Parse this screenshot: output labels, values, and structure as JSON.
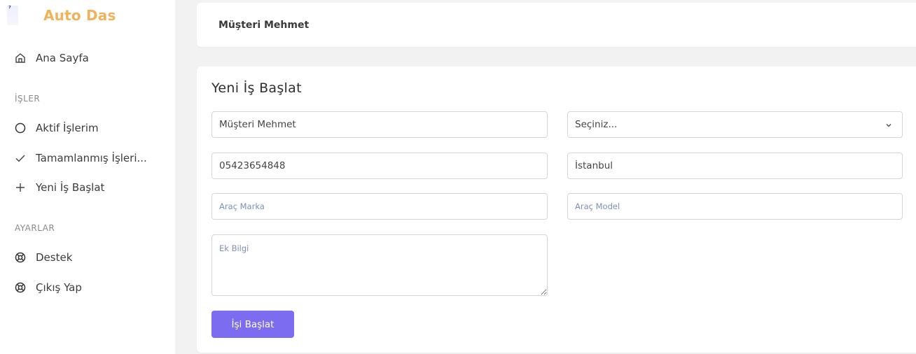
{
  "sidebar": {
    "brand": "Auto Das",
    "home": {
      "label": "Ana Sayfa",
      "icon": "home-icon"
    },
    "section_jobs": "İŞLER",
    "jobs_items": [
      {
        "label": "Aktif İşlerim",
        "icon": "circle-icon"
      },
      {
        "label": "Tamamlanmış İşleri...",
        "icon": "check-icon"
      },
      {
        "label": "Yeni İş Başlat",
        "icon": "plus-icon"
      }
    ],
    "section_settings": "AYARLAR",
    "settings_items": [
      {
        "label": "Destek",
        "icon": "lifebuoy-icon"
      },
      {
        "label": "Çıkış Yap",
        "icon": "lifebuoy-icon"
      }
    ]
  },
  "header": {
    "customer_name": "Müşteri Mehmet"
  },
  "form": {
    "title": "Yeni İş Başlat",
    "name_value": "Müşteri Mehmet",
    "select_value": "Seçiniz...",
    "phone_value": "05423654848",
    "city_value": "İstanbul",
    "brand_placeholder": "Araç Marka",
    "model_placeholder": "Araç Model",
    "info_placeholder": "Ek Bilgi",
    "submit_label": "İşi Başlat"
  },
  "colors": {
    "brand": "#f0b35b",
    "accent": "#7b6cf0"
  }
}
